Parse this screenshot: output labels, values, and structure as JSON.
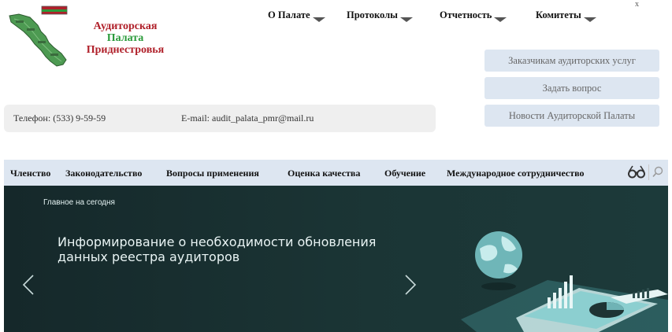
{
  "header": {
    "org_name": {
      "line1": "Аудиторская",
      "line2": "Палата",
      "line3": "Приднестровья"
    },
    "top_nav": [
      {
        "label": "О Палате"
      },
      {
        "label": "Протоколы"
      },
      {
        "label": "Отчетность"
      },
      {
        "label": "Комитеты"
      }
    ],
    "close_glyph": "x"
  },
  "side_buttons": [
    {
      "label": "Заказчикам аудиторских услуг"
    },
    {
      "label": "Задать вопрос"
    },
    {
      "label": "Новости Аудиторской Палаты"
    }
  ],
  "contacts": {
    "phone": "Телефон: (533) 9-59-59",
    "email": "E-mail: audit_palata_pmr@mail.ru"
  },
  "main_nav": [
    {
      "label": "Членство"
    },
    {
      "label": "Законодательство"
    },
    {
      "label": "Вопросы применения"
    },
    {
      "label": "Оценка качества"
    },
    {
      "label": "Обучение"
    },
    {
      "label": "Международное сотрудничество"
    }
  ],
  "banner": {
    "tag": "Главное на сегодня",
    "title": "Информирование о необходимости обновления данных реестра аудиторов"
  },
  "icons": {
    "glasses": "glasses-icon",
    "search": "search-icon",
    "arrow_left": "chevron-left-icon",
    "arrow_right": "chevron-right-icon"
  },
  "colors": {
    "nav_bg": "#dde6f1",
    "org_red": "#b0202a",
    "org_green": "#2a9a3a",
    "banner_bg": "#1b3535"
  }
}
